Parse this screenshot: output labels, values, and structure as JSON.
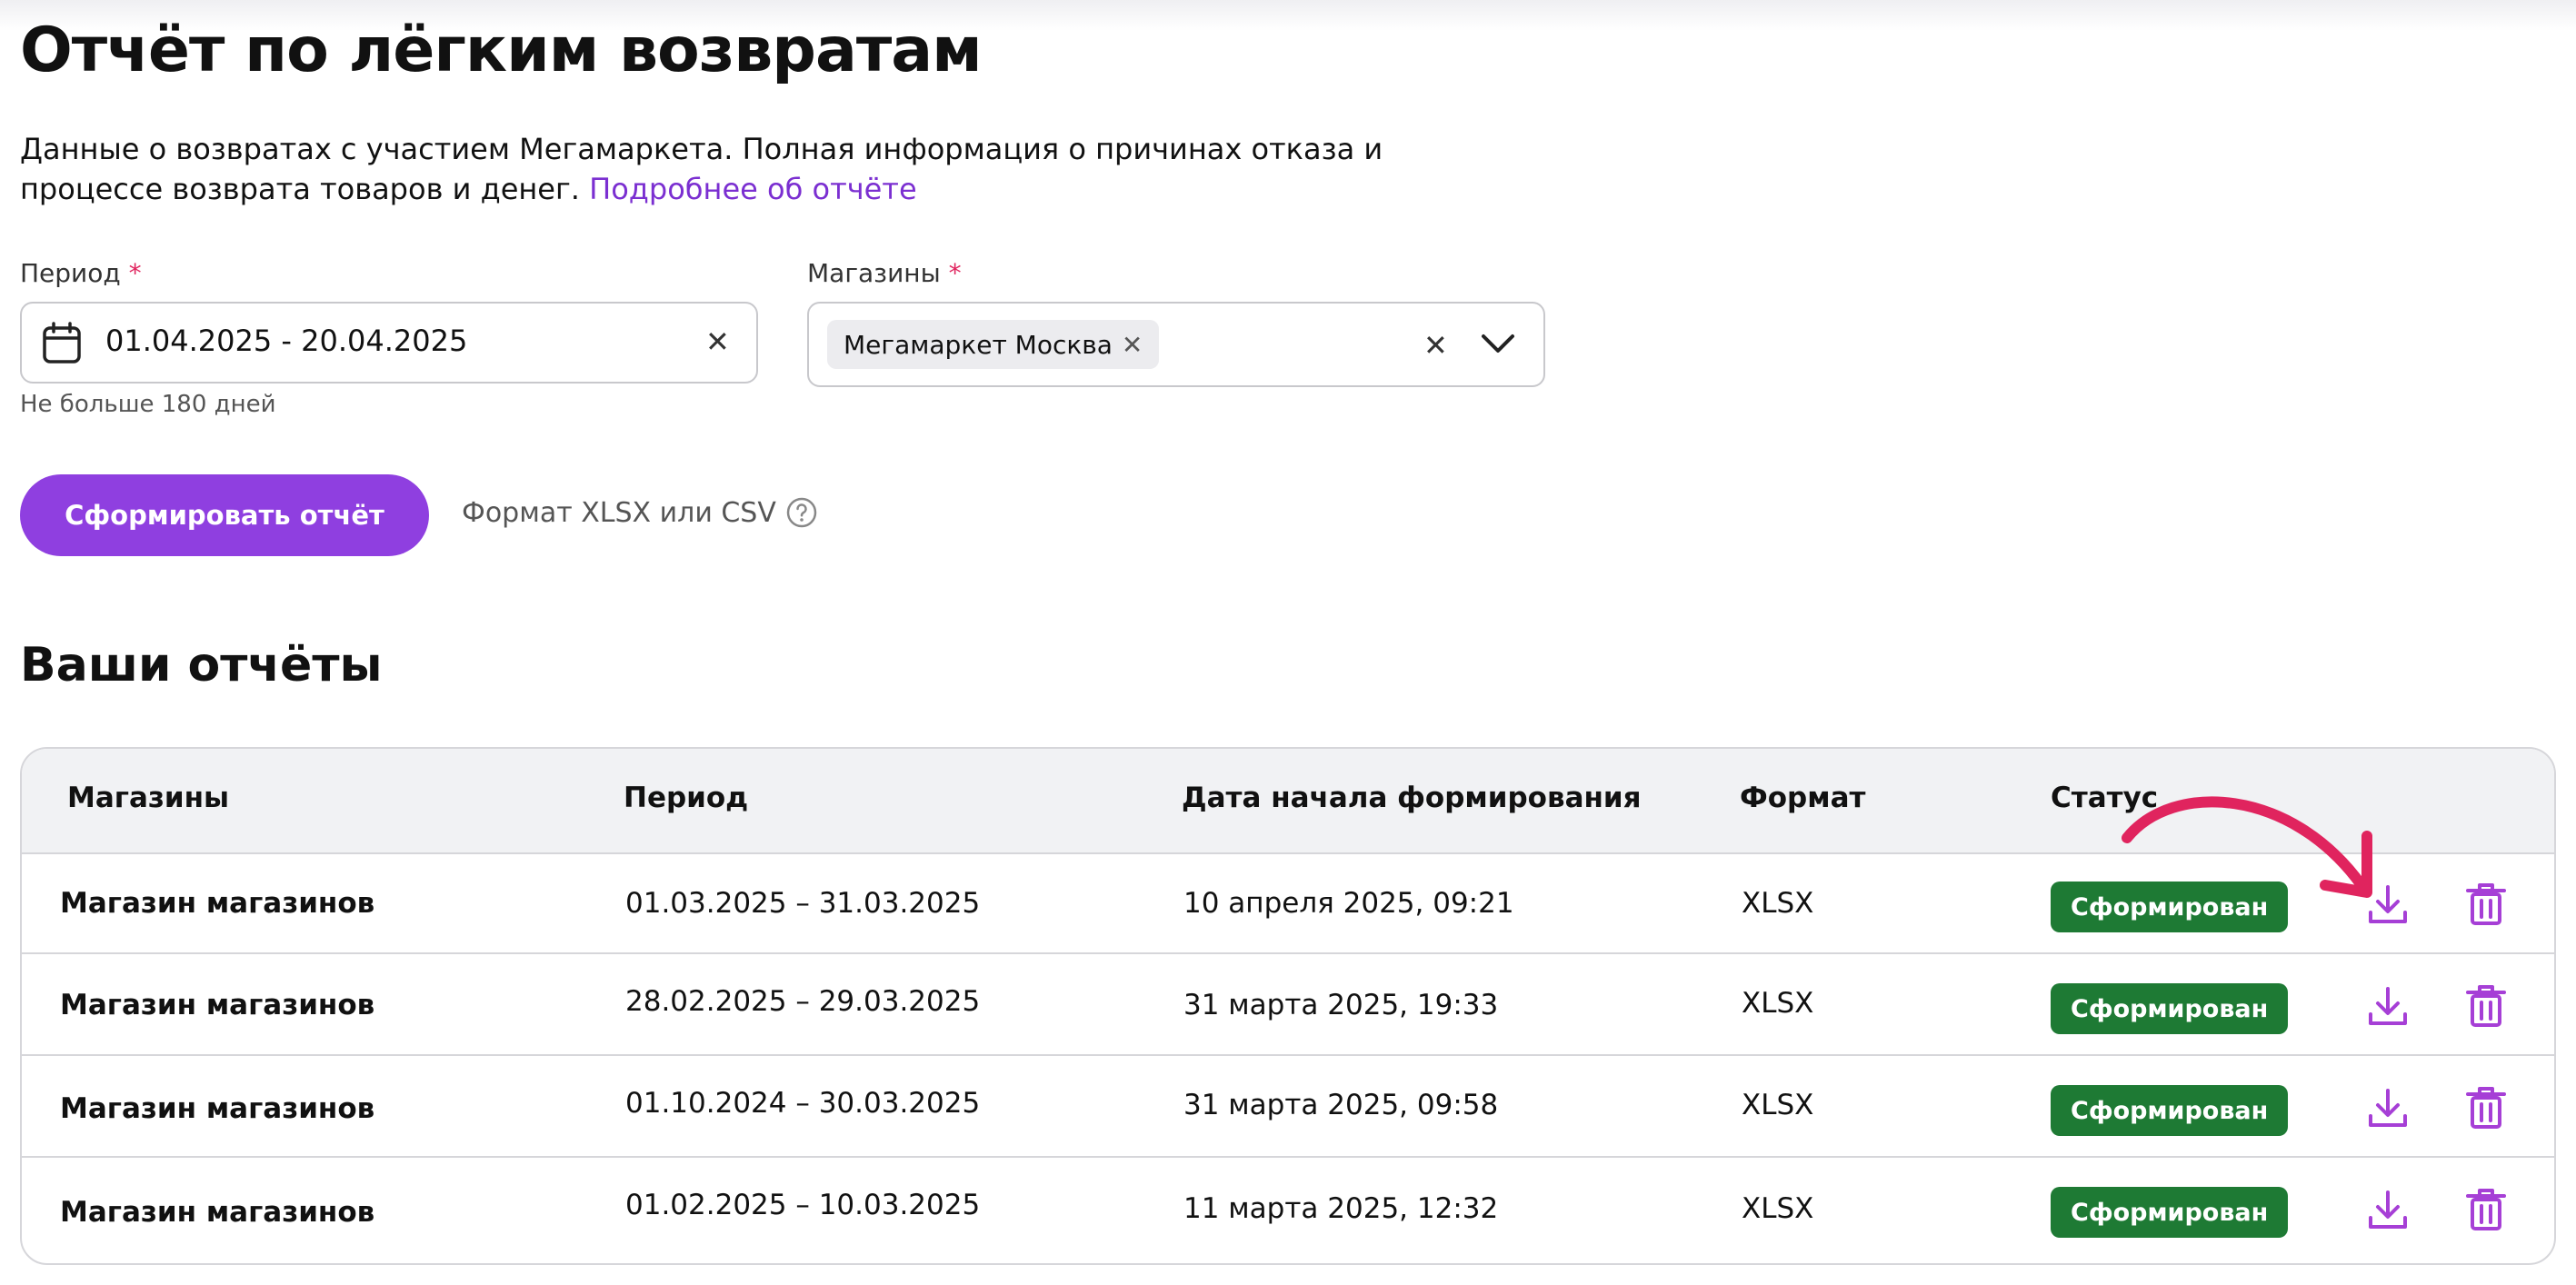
{
  "page": {
    "title": "Отчёт по лёгким возвратам",
    "description": "Данные о возвратах с участием Мегамаркета. Полная информация о причинах отказа и процессе возврата товаров и денег.",
    "more_link": "Подробнее об отчёте"
  },
  "form": {
    "period_label": "Период",
    "shops_label": "Магазины",
    "required_mark": "*",
    "period_value": "01.04.2025 - 20.04.2025",
    "period_hint": "Не больше 180 дней",
    "shop_chip": "Мегамаркет Москва",
    "generate_button": "Сформировать отчёт",
    "format_note": "Формат XLSX или CSV"
  },
  "reports": {
    "title": "Ваши отчёты",
    "columns": [
      "Магазины",
      "Период",
      "Дата начала формирования",
      "Формат",
      "Статус"
    ],
    "rows": [
      {
        "shop": "Магазин магазинов",
        "period": "01.03.2025 – 31.03.2025",
        "started": "10 апреля 2025, 09:21",
        "format": "XLSX",
        "status": "Сформирован"
      },
      {
        "shop": "Магазин магазинов",
        "period": "28.02.2025 – 29.03.2025",
        "started": "31 марта 2025, 19:33",
        "format": "XLSX",
        "status": "Сформирован"
      },
      {
        "shop": "Магазин магазинов",
        "period": "01.10.2024 – 30.03.2025",
        "started": "31 марта 2025, 09:58",
        "format": "XLSX",
        "status": "Сформирован"
      },
      {
        "shop": "Магазин магазинов",
        "period": "01.02.2025 – 10.03.2025",
        "started": "11 марта 2025, 12:32",
        "format": "XLSX",
        "status": "Сформирован"
      }
    ]
  },
  "icons": {
    "calendar": "calendar-icon",
    "clear": "close-icon",
    "chevron": "chevron-down-icon",
    "help": "question-circle-icon",
    "download": "download-icon",
    "delete": "trash-icon",
    "annotation": "curved-arrow-icon"
  },
  "colors": {
    "accent": "#8f3fe0",
    "link": "#7b2fd1",
    "status_done": "#1e7a34",
    "required": "#e0245e",
    "action_icon": "#a63fd6",
    "annotation_arrow": "#e0245e"
  }
}
